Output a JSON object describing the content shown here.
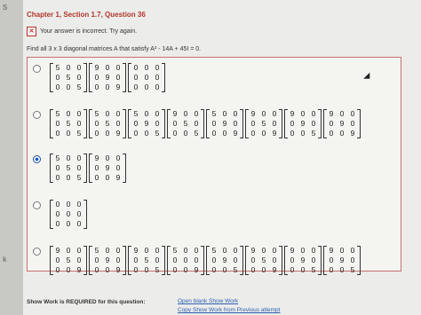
{
  "sidebar": {
    "marks": [
      "S",
      "k"
    ]
  },
  "header": {
    "title": "Chapter 1, Section 1.7, Question 36",
    "status": "Your answer is incorrect.  Try again.",
    "question": "Find all 3 x 3 diagonal matrices A that satisfy A² - 14A + 45I = 0."
  },
  "options": [
    {
      "selected": false,
      "matrices": [
        [
          [
            5,
            0,
            0
          ],
          [
            0,
            5,
            0
          ],
          [
            0,
            0,
            5
          ]
        ],
        [
          [
            9,
            0,
            0
          ],
          [
            0,
            9,
            0
          ],
          [
            0,
            0,
            9
          ]
        ],
        [
          [
            0,
            0,
            0
          ],
          [
            0,
            0,
            0
          ],
          [
            0,
            0,
            0
          ]
        ]
      ]
    },
    {
      "selected": false,
      "matrices": [
        [
          [
            5,
            0,
            0
          ],
          [
            0,
            5,
            0
          ],
          [
            0,
            0,
            5
          ]
        ],
        [
          [
            5,
            0,
            0
          ],
          [
            0,
            5,
            0
          ],
          [
            0,
            0,
            9
          ]
        ],
        [
          [
            5,
            0,
            0
          ],
          [
            0,
            9,
            0
          ],
          [
            0,
            0,
            5
          ]
        ],
        [
          [
            9,
            0,
            0
          ],
          [
            0,
            5,
            0
          ],
          [
            0,
            0,
            5
          ]
        ],
        [
          [
            5,
            0,
            0
          ],
          [
            0,
            9,
            0
          ],
          [
            0,
            0,
            9
          ]
        ],
        [
          [
            9,
            0,
            0
          ],
          [
            0,
            5,
            0
          ],
          [
            0,
            0,
            9
          ]
        ],
        [
          [
            9,
            0,
            0
          ],
          [
            0,
            9,
            0
          ],
          [
            0,
            0,
            5
          ]
        ],
        [
          [
            9,
            0,
            0
          ],
          [
            0,
            9,
            0
          ],
          [
            0,
            0,
            9
          ]
        ]
      ]
    },
    {
      "selected": true,
      "matrices": [
        [
          [
            5,
            0,
            0
          ],
          [
            0,
            5,
            0
          ],
          [
            0,
            0,
            5
          ]
        ],
        [
          [
            9,
            0,
            0
          ],
          [
            0,
            9,
            0
          ],
          [
            0,
            0,
            9
          ]
        ]
      ]
    },
    {
      "selected": false,
      "matrices": [
        [
          [
            0,
            0,
            0
          ],
          [
            0,
            0,
            0
          ],
          [
            0,
            0,
            0
          ]
        ]
      ]
    },
    {
      "selected": false,
      "matrices": [
        [
          [
            9,
            0,
            0
          ],
          [
            0,
            5,
            0
          ],
          [
            0,
            0,
            9
          ]
        ],
        [
          [
            5,
            0,
            0
          ],
          [
            0,
            9,
            0
          ],
          [
            0,
            0,
            9
          ]
        ],
        [
          [
            9,
            0,
            0
          ],
          [
            0,
            5,
            0
          ],
          [
            0,
            0,
            5
          ]
        ],
        [
          [
            5,
            0,
            0
          ],
          [
            0,
            0,
            0
          ],
          [
            0,
            0,
            9
          ]
        ],
        [
          [
            5,
            0,
            0
          ],
          [
            0,
            9,
            0
          ],
          [
            0,
            0,
            5
          ]
        ],
        [
          [
            9,
            0,
            0
          ],
          [
            0,
            5,
            0
          ],
          [
            0,
            0,
            9
          ]
        ],
        [
          [
            9,
            0,
            0
          ],
          [
            0,
            9,
            0
          ],
          [
            0,
            0,
            5
          ]
        ],
        [
          [
            9,
            0,
            0
          ],
          [
            0,
            9,
            0
          ],
          [
            0,
            0,
            5
          ]
        ]
      ]
    }
  ],
  "footer": {
    "required": "Show Work is REQUIRED for this question:",
    "open_link": "Open blank Show Work",
    "copy_link": "Copy Show Work from Previous attempt"
  },
  "colors": {
    "title": "#b2362c",
    "box_border": "#c7706a",
    "link": "#2b5fb3",
    "radio_selected": "#1a5fd0"
  }
}
